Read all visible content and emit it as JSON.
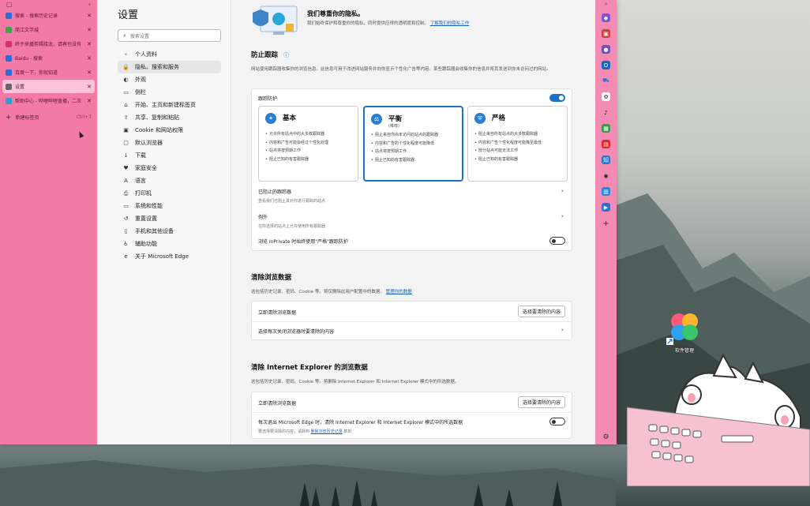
{
  "tabs": [
    {
      "label": "搜索 - 搜索历史记录",
      "icon": "search-tab-icon",
      "color": "#2b6fd6"
    },
    {
      "label": "简江文学城",
      "icon": "book-tab-icon",
      "color": "#3fa34d"
    },
    {
      "label": "终于来播剪辑接龙，请再也没有",
      "icon": "video-tab-icon",
      "color": "#d6336c"
    },
    {
      "label": "Baidu - 搜索",
      "icon": "baidu-tab-icon",
      "color": "#2b6fd6"
    },
    {
      "label": "百度一下，你就知道",
      "icon": "baidu-tab-icon",
      "color": "#2b6fd6"
    },
    {
      "label": "设置",
      "icon": "settings-tab-icon",
      "color": "#666666",
      "active": true
    },
    {
      "label": "帮助中心 - 哔哩哔哩直播，二次",
      "icon": "bilibili-tab-icon",
      "color": "#2e9ad6"
    }
  ],
  "new_tab": {
    "label": "新建标签页",
    "shortcut": "Ctrl+T"
  },
  "settings": {
    "title": "设置",
    "search_placeholder": "搜索设置",
    "nav": [
      {
        "label": "个人资料",
        "icon": "profile-icon"
      },
      {
        "label": "隐私、搜索和服务",
        "icon": "lock-icon",
        "active": true
      },
      {
        "label": "外观",
        "icon": "appearance-icon"
      },
      {
        "label": "侧栏",
        "icon": "sidebar-icon"
      },
      {
        "label": "开始、主页和新建标签页",
        "icon": "home-icon"
      },
      {
        "label": "共享、复制和粘贴",
        "icon": "share-icon"
      },
      {
        "label": "Cookie 和网站权限",
        "icon": "cookie-icon"
      },
      {
        "label": "默认浏览器",
        "icon": "browser-icon"
      },
      {
        "label": "下载",
        "icon": "download-icon"
      },
      {
        "label": "家庭安全",
        "icon": "family-icon"
      },
      {
        "label": "语言",
        "icon": "language-icon"
      },
      {
        "label": "打印机",
        "icon": "printer-icon"
      },
      {
        "label": "系统和性能",
        "icon": "system-icon"
      },
      {
        "label": "重置设置",
        "icon": "reset-icon"
      },
      {
        "label": "手机和其他设备",
        "icon": "phone-icon"
      },
      {
        "label": "辅助功能",
        "icon": "accessibility-icon"
      },
      {
        "label": "关于 Microsoft Edge",
        "icon": "edge-icon"
      }
    ]
  },
  "privacy": {
    "title": "我们尊重你的隐私。",
    "desc": "我们始终保护和尊重你的隐私，同时提供应得的透明度和控制。",
    "link": "了解我们的隐私工作"
  },
  "tracking": {
    "title": "防止跟踪",
    "desc": "网站使用跟踪器收集你的浏览信息。此信息可用于改进网站服务并向你显示个性化广告等内容。某些跟踪器会收集你的信息并将其发送到你未访问过的网站。",
    "toggle_label": "跟踪防护",
    "toggle_on": true,
    "options": [
      {
        "title": "基本",
        "sub": "",
        "items": [
          "允许所有站点中的大多数跟踪器",
          "内容和广告可能会经过个性化处理",
          "站点将按预期工作",
          "阻止已知的有害跟踪器"
        ]
      },
      {
        "title": "平衡",
        "sub": "(推荐)",
        "selected": true,
        "items": [
          "阻止来自你尚未访问的站点的跟踪器",
          "内容和广告的个性化程度可能降低",
          "站点将按预期工作",
          "阻止已知的有害跟踪器"
        ]
      },
      {
        "title": "严格",
        "sub": "",
        "items": [
          "阻止来自所有站点的大多数跟踪器",
          "内容和广告个性化程度可能降至最低",
          "部分站点可能无法工作",
          "阻止已知的有害跟踪器"
        ]
      }
    ],
    "blocked": {
      "label": "已阻止的跟踪器",
      "sub": "查看我们已阻止其对你进行跟踪的站点"
    },
    "exceptions": {
      "label": "例外",
      "sub": "在你选择的站点上允许使用所有跟踪器"
    },
    "inprivate": {
      "label": "浏览 InPrivate 时始终使用\"严格\"跟踪防护",
      "on": false
    }
  },
  "clear": {
    "title": "清除浏览数据",
    "desc": "这包括历史记录、密码、Cookie 等。将仅删除此用户配置中的数据。",
    "link": "管理你的数据",
    "now_label": "立即清除浏览数据",
    "now_button": "选择要清除的内容",
    "on_close_label": "选择每次关闭浏览器时要清除的内容"
  },
  "ie": {
    "title": "清除 Internet Explorer 的浏览数据",
    "desc": "这包括历史记录、密码、Cookie 等。将删除 Internet Explorer 和 Internet Explorer 模式中的所选数据。",
    "now_label": "立即清除浏览数据",
    "now_button": "选择要清除的内容",
    "exit_label": "每次退出 Microsoft Edge 时，清除 Internet Explorer 和 Internet Explorer 模式中的所选数据",
    "exit_sub": "要选择要清除的内容，请转到",
    "exit_link": "删除浏览历史记录",
    "exit_tail": "菜单",
    "exit_on": false
  },
  "desktop": {
    "app_label": "软件管理"
  },
  "colors": {
    "tab_bar": "#f47aa6",
    "right_bar": "#f48bb2",
    "accent": "#1a73c8"
  }
}
